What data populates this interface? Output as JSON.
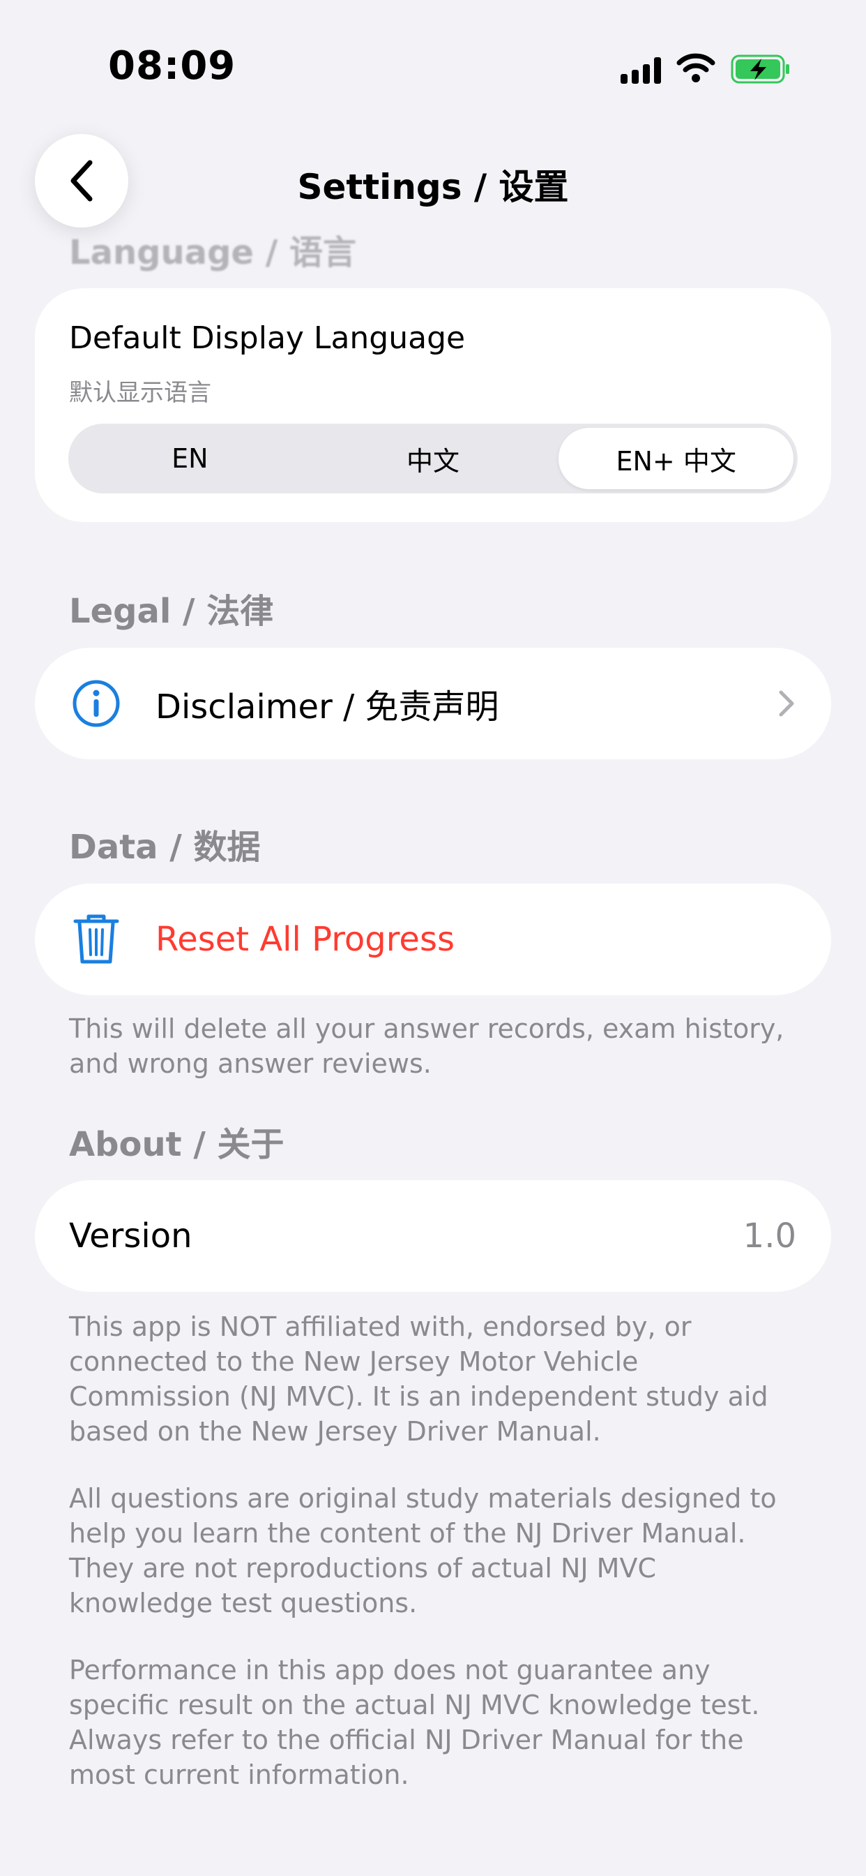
{
  "status_bar": {
    "time": "08:09"
  },
  "nav": {
    "title": "Settings / 设置"
  },
  "language_section": {
    "header": "Language / 语言",
    "title": "Default Display Language",
    "subtitle": "默认显示语言",
    "options": [
      "EN",
      "中文",
      "EN+ 中文"
    ],
    "selected": "EN+ 中文"
  },
  "legal_section": {
    "header": "Legal / 法律",
    "disclaimer_label": "Disclaimer / 免责声明"
  },
  "data_section": {
    "header": "Data / 数据",
    "reset_label": "Reset All Progress",
    "reset_note": "This will delete all your answer records, exam history, and wrong answer reviews."
  },
  "about_section": {
    "header": "About / 关于",
    "version_label": "Version",
    "version_value": "1.0",
    "notes": [
      "This app is NOT affiliated with, endorsed by, or connected to the New Jersey Motor Vehicle Commission (NJ MVC). It is an independent study aid based on the New Jersey Driver Manual.",
      "All questions are original study materials designed to help you learn the content of the NJ Driver Manual. They are not reproductions of actual NJ MVC knowledge test questions.",
      "Performance in this app does not guarantee any specific result on the actual NJ MVC knowledge test. Always refer to the official NJ Driver Manual for the most current information."
    ]
  },
  "colors": {
    "background": "#f2f2f7",
    "accent_blue": "#1a7fe0",
    "destructive_red": "#ff3b30",
    "battery_green": "#34c759",
    "secondary_text": "#8a8a8e"
  }
}
